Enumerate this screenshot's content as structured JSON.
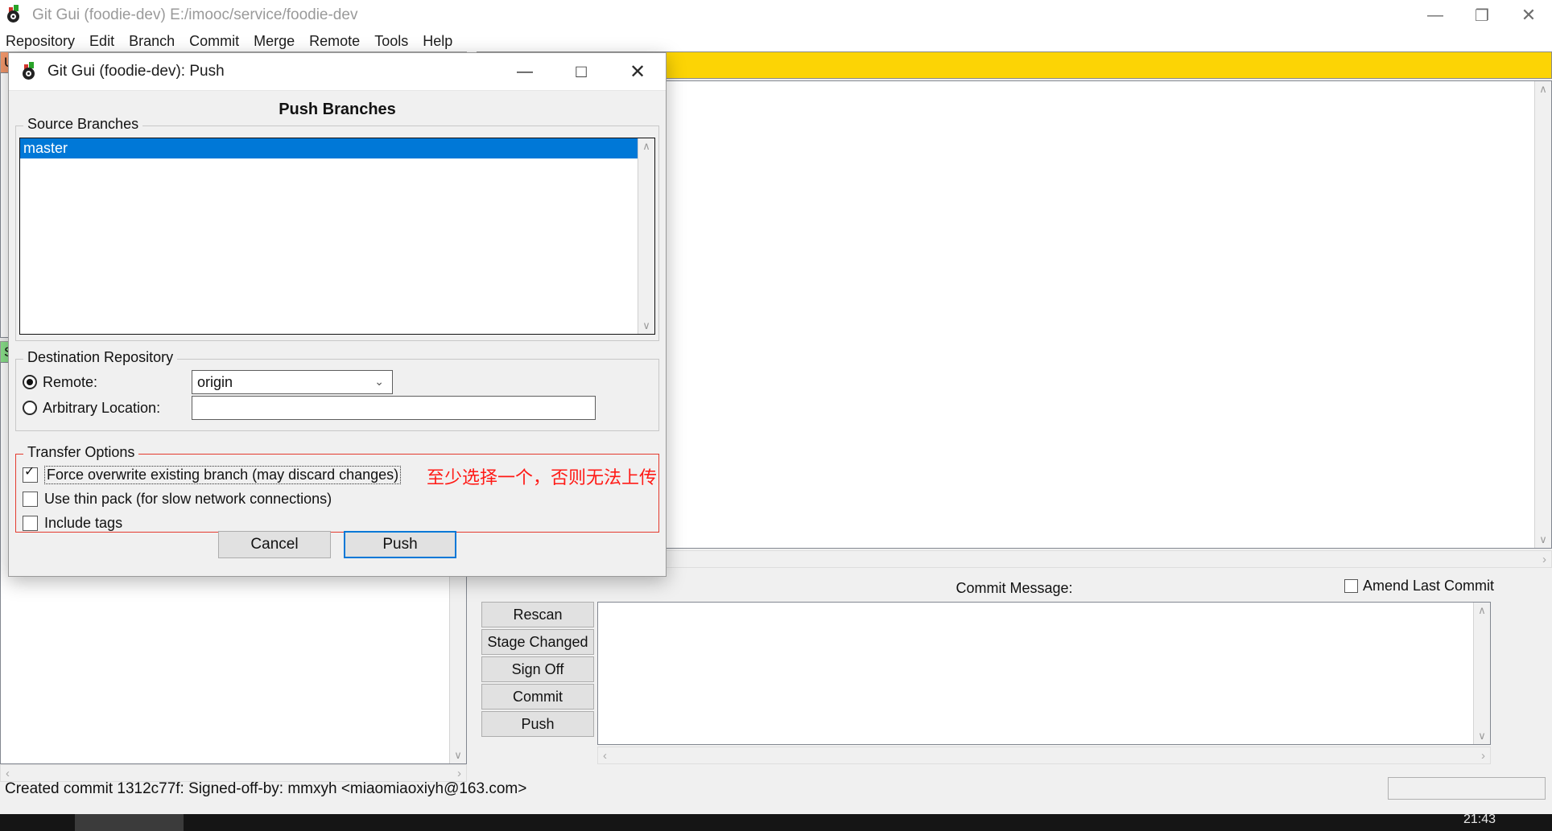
{
  "main_window": {
    "title": "Git Gui (foodie-dev) E:/imooc/service/foodie-dev",
    "icon": "git-gui-icon",
    "controls": {
      "minimize": "—",
      "maximize": "❐",
      "close": "✕"
    },
    "menubar": [
      "Repository",
      "Edit",
      "Branch",
      "Commit",
      "Merge",
      "Remote",
      "Tools",
      "Help"
    ],
    "panels": {
      "unstaged_label": "U",
      "staged_label": "S"
    },
    "scroll": {
      "up": "∧",
      "down": "∨",
      "left": "‹",
      "right": "›"
    },
    "commit": {
      "message_label": "Commit Message:",
      "amend_label": "Amend Last Commit",
      "amend_checked": false,
      "message_value": "",
      "buttons": [
        "Rescan",
        "Stage Changed",
        "Sign Off",
        "Commit",
        "Push"
      ]
    },
    "statusbar": "Created commit 1312c77f: Signed-off-by: mmxyh <miaomiaoxiyh@163.com>",
    "taskbar_clock": "21:43"
  },
  "dialog": {
    "icon": "git-gui-icon",
    "title": "Git Gui (foodie-dev): Push",
    "controls": {
      "minimize": "—",
      "maximize": "□",
      "close": "✕"
    },
    "heading": "Push Branches",
    "source_branches": {
      "group_label": "Source Branches",
      "items": [
        "master"
      ],
      "selected": "master"
    },
    "destination": {
      "group_label": "Destination Repository",
      "remote_label": "Remote:",
      "remote_selected": true,
      "remote_value": "origin",
      "remote_options": [
        "origin"
      ],
      "arbitrary_label": "Arbitrary Location:",
      "arbitrary_selected": false,
      "arbitrary_value": ""
    },
    "transfer_options": {
      "group_label": "Transfer Options",
      "items": [
        {
          "label": "Force overwrite existing branch (may discard changes)",
          "checked": true,
          "focused": true
        },
        {
          "label": "Use thin pack (for slow network connections)",
          "checked": false,
          "focused": false
        },
        {
          "label": "Include tags",
          "checked": false,
          "focused": false
        }
      ],
      "highlight_color": "#e43b2f"
    },
    "annotation": {
      "text": "至少选择一个，否则无法上传",
      "color": "#ff1a16"
    },
    "buttons": {
      "cancel": "Cancel",
      "push": "Push"
    }
  },
  "colors": {
    "selection_blue": "#0078d7",
    "accent_yellow": "#fcd405",
    "unstaged_orange": "#f0966a",
    "staged_green": "#8ae08a"
  }
}
